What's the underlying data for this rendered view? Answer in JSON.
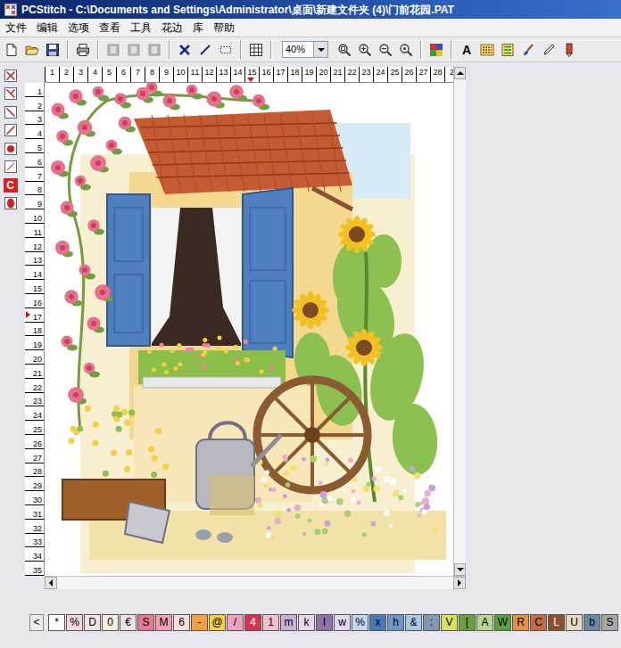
{
  "window": {
    "title": "PCStitch - C:\\Documents and Settings\\Administrator\\桌面\\新建文件夹 (4)\\门前花园.PAT"
  },
  "menu": [
    "文件",
    "编辑",
    "选项",
    "查看",
    "工具",
    "花边",
    "库",
    "帮助"
  ],
  "toolbar": {
    "items": [
      {
        "kind": "new"
      },
      {
        "kind": "open"
      },
      {
        "kind": "save"
      },
      {
        "kind": "separator"
      },
      {
        "kind": "print"
      },
      {
        "kind": "separator"
      },
      {
        "kind": "disabled"
      },
      {
        "kind": "disabled"
      },
      {
        "kind": "disabled"
      },
      {
        "kind": "separator"
      },
      {
        "kind": "cross"
      },
      {
        "kind": "line"
      },
      {
        "kind": "select"
      },
      {
        "kind": "separator"
      },
      {
        "kind": "grid"
      },
      {
        "kind": "separator"
      },
      {
        "kind": "zoom",
        "value": "40%"
      },
      {
        "kind": "zoom-fit"
      },
      {
        "kind": "zoom-in"
      },
      {
        "kind": "zoom-out"
      },
      {
        "kind": "zoom-window"
      },
      {
        "kind": "separator"
      },
      {
        "kind": "colors"
      },
      {
        "kind": "separator"
      },
      {
        "kind": "text",
        "label": "A"
      },
      {
        "kind": "symbols"
      },
      {
        "kind": "list"
      },
      {
        "kind": "brush"
      },
      {
        "kind": "dropper"
      },
      {
        "kind": "pencil"
      }
    ]
  },
  "stitch_tools": [
    {
      "kind": "full-cross"
    },
    {
      "kind": "half-cross"
    },
    {
      "kind": "quarter-left"
    },
    {
      "kind": "quarter-right"
    },
    {
      "kind": "french-knot"
    },
    {
      "kind": "backstitch"
    },
    {
      "kind": "text",
      "label": "C"
    },
    {
      "kind": "bead"
    }
  ],
  "ruler": {
    "columns": [
      {
        "label": "1",
        "marked": false
      },
      {
        "label": "2",
        "marked": false
      },
      {
        "label": "3",
        "marked": false
      },
      {
        "label": "4",
        "marked": false
      },
      {
        "label": "5",
        "marked": false
      },
      {
        "label": "6",
        "marked": false
      },
      {
        "label": "7",
        "marked": false
      },
      {
        "label": "8",
        "marked": false
      },
      {
        "label": "9",
        "marked": false
      },
      {
        "label": "10",
        "marked": false
      },
      {
        "label": "11",
        "marked": false
      },
      {
        "label": "12",
        "marked": false
      },
      {
        "label": "13",
        "marked": false
      },
      {
        "label": "14",
        "marked": false
      },
      {
        "label": "15",
        "marked": true
      },
      {
        "label": "16",
        "marked": false
      },
      {
        "label": "17",
        "marked": false
      },
      {
        "label": "18",
        "marked": false
      },
      {
        "label": "19",
        "marked": false
      },
      {
        "label": "20",
        "marked": false
      },
      {
        "label": "21",
        "marked": false
      },
      {
        "label": "22",
        "marked": false
      },
      {
        "label": "23",
        "marked": false
      },
      {
        "label": "24",
        "marked": false
      },
      {
        "label": "25",
        "marked": false
      },
      {
        "label": "26",
        "marked": false
      },
      {
        "label": "27",
        "marked": false
      },
      {
        "label": "28",
        "marked": false
      },
      {
        "label": "2",
        "marked": false
      }
    ],
    "rows": [
      {
        "label": "1",
        "marked": false
      },
      {
        "label": "2",
        "marked": false
      },
      {
        "label": "3",
        "marked": false
      },
      {
        "label": "4",
        "marked": false
      },
      {
        "label": "5",
        "marked": false
      },
      {
        "label": "6",
        "marked": false
      },
      {
        "label": "7",
        "marked": false
      },
      {
        "label": "8",
        "marked": false
      },
      {
        "label": "9",
        "marked": false
      },
      {
        "label": "10",
        "marked": false
      },
      {
        "label": "11",
        "marked": false
      },
      {
        "label": "12",
        "marked": false
      },
      {
        "label": "13",
        "marked": false
      },
      {
        "label": "14",
        "marked": false
      },
      {
        "label": "15",
        "marked": false
      },
      {
        "label": "16",
        "marked": false
      },
      {
        "label": "17",
        "marked": true
      },
      {
        "label": "18",
        "marked": false
      },
      {
        "label": "19",
        "marked": false
      },
      {
        "label": "20",
        "marked": false
      },
      {
        "label": "21",
        "marked": false
      },
      {
        "label": "22",
        "marked": false
      },
      {
        "label": "23",
        "marked": false
      },
      {
        "label": "24",
        "marked": false
      },
      {
        "label": "25",
        "marked": false
      },
      {
        "label": "26",
        "marked": false
      },
      {
        "label": "27",
        "marked": false
      },
      {
        "label": "28",
        "marked": false
      },
      {
        "label": "29",
        "marked": false
      },
      {
        "label": "30",
        "marked": false
      },
      {
        "label": "31",
        "marked": false
      },
      {
        "label": "32",
        "marked": false
      },
      {
        "label": "33",
        "marked": false
      },
      {
        "label": "34",
        "marked": false
      },
      {
        "label": "35",
        "marked": false
      }
    ]
  },
  "palette": {
    "scroll_left": "<",
    "swatches": [
      {
        "symbol": "*",
        "color": "#ffffff"
      },
      {
        "symbol": "%",
        "color": "#f4d6dc"
      },
      {
        "symbol": "D",
        "color": "#f0e6e0"
      },
      {
        "symbol": "0",
        "color": "#f5eedc"
      },
      {
        "symbol": "€",
        "color": "#f0e0e6"
      },
      {
        "symbol": "S",
        "color": "#e87890"
      },
      {
        "symbol": "M",
        "color": "#f0a0b0"
      },
      {
        "symbol": "6",
        "color": "#f5dede"
      },
      {
        "symbol": "-",
        "color": "#f0a040"
      },
      {
        "symbol": "@",
        "color": "#f6d040"
      },
      {
        "symbol": "/",
        "color": "#f0a0c0"
      },
      {
        "symbol": "4",
        "color": "#d83050"
      },
      {
        "symbol": "1",
        "color": "#f4c0cc"
      },
      {
        "symbol": "m",
        "color": "#c8b0d8"
      },
      {
        "symbol": "k",
        "color": "#e6d8ec"
      },
      {
        "symbol": "I",
        "color": "#9070a8"
      },
      {
        "symbol": "w",
        "color": "#e0d8f0"
      },
      {
        "symbol": "%",
        "color": "#c0d8f0"
      },
      {
        "symbol": "x",
        "color": "#4a78b8"
      },
      {
        "symbol": "h",
        "color": "#6a98c8"
      },
      {
        "symbol": "&",
        "color": "#a8c8e8"
      },
      {
        "symbol": ":",
        "color": "#8098b0"
      },
      {
        "symbol": "V",
        "color": "#d8e060"
      },
      {
        "symbol": "[",
        "color": "#6aa040"
      },
      {
        "symbol": "A",
        "color": "#b8d890"
      },
      {
        "symbol": "W",
        "color": "#58a040"
      },
      {
        "symbol": "R",
        "color": "#e89040"
      },
      {
        "symbol": "C",
        "color": "#c07040"
      },
      {
        "symbol": "L",
        "color": "#8a5030"
      },
      {
        "symbol": "U",
        "color": "#e8d8c0"
      },
      {
        "symbol": "b",
        "color": "#6a88a8"
      },
      {
        "symbol": "S",
        "color": "#a8a8a8"
      }
    ]
  }
}
